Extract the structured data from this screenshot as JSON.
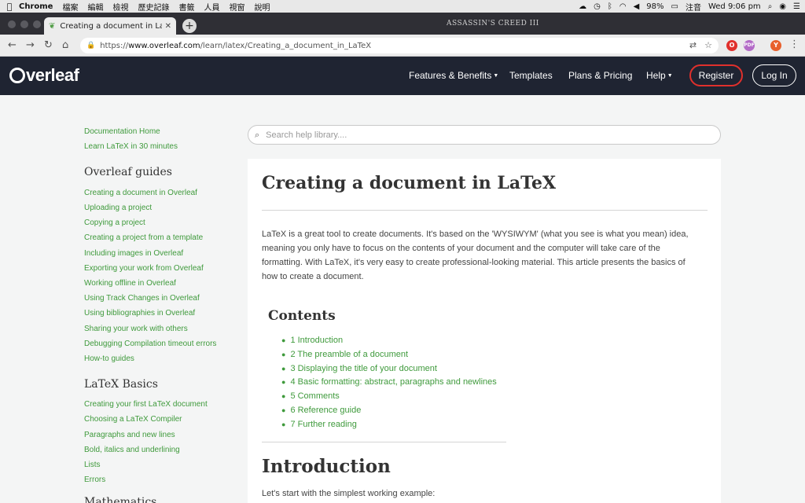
{
  "menubar": {
    "items": [
      "Chrome",
      "檔案",
      "編輯",
      "檢視",
      "歷史記錄",
      "書籤",
      "人員",
      "視窗",
      "說明"
    ],
    "battery": "98%",
    "ime": "注音",
    "clock": "Wed 9:06 pm"
  },
  "browser": {
    "tab_title": "Creating a document in LaTeX",
    "tab_brand_text": "ASSASSIN'S CREED III",
    "url_prefix": "https://",
    "url_host": "www.overleaf.com",
    "url_path": "/learn/latex/Creating_a_document_in_LaTeX",
    "ext_avatar": "Y",
    "ext_pdf": "PDF"
  },
  "navbar": {
    "logo": "verleaf",
    "features": "Features & Benefits",
    "templates": "Templates",
    "plans": "Plans & Pricing",
    "help": "Help",
    "register": "Register",
    "login": "Log In"
  },
  "sidebar": {
    "top_links": [
      "Documentation Home",
      "Learn LaTeX in 30 minutes"
    ],
    "guides_heading": "Overleaf guides",
    "guides": [
      "Creating a document in Overleaf",
      "Uploading a project",
      "Copying a project",
      "Creating a project from a template",
      "Including images in Overleaf",
      "Exporting your work from Overleaf",
      "Working offline in Overleaf",
      "Using Track Changes in Overleaf",
      "Using bibliographies in Overleaf",
      "Sharing your work with others",
      "Debugging Compilation timeout errors",
      "How-to guides"
    ],
    "basics_heading": "LaTeX Basics",
    "basics": [
      "Creating your first LaTeX document",
      "Choosing a LaTeX Compiler",
      "Paragraphs and new lines",
      "Bold, italics and underlining",
      "Lists",
      "Errors"
    ],
    "next_heading": "Mathematics"
  },
  "search": {
    "placeholder": "Search help library...."
  },
  "article": {
    "title": "Creating a document in LaTeX",
    "intro_p1_a": " is a great tool to create documents. It's based on the 'WYSIWYM' (what you see is what you mean) idea, meaning you only have to focus on the contents of your document and the computer will take care of the formatting. With ",
    "intro_p1_b": ", it's very easy to create professional-looking material. This article presents the basics of how to create a document.",
    "latex_logo": "LaTeX",
    "contents_heading": "Contents",
    "toc": [
      "1 Introduction",
      "2 The preamble of a document",
      "3 Displaying the title of your document",
      "4 Basic formatting: abstract, paragraphs and newlines",
      "5 Comments",
      "6 Reference guide",
      "7 Further reading"
    ],
    "section_heading": "Introduction",
    "section_text": "Let's start with the simplest working example:"
  },
  "colors": {
    "link_green": "#3f9a3c",
    "navbar_bg": "#1f2432",
    "register_border": "#e0302c"
  }
}
